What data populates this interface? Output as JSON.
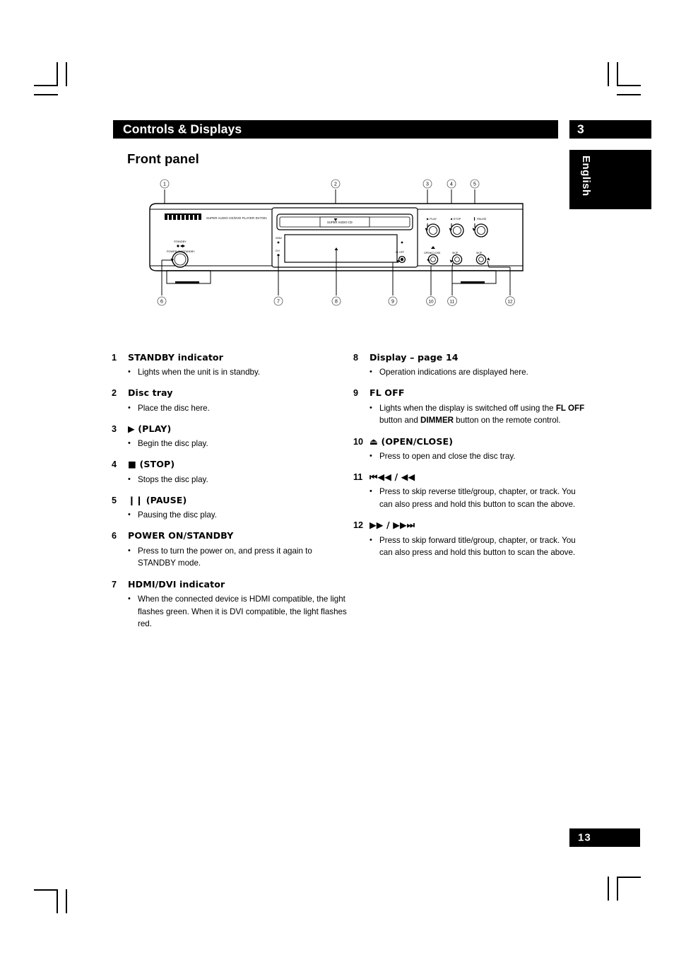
{
  "header": {
    "title": "Controls & Displays",
    "chapter": "3",
    "language_tab": "English"
  },
  "section": {
    "title": "Front panel"
  },
  "figure": {
    "brand": "marantz",
    "model_line": "SUPER AUDIO CD/DVD PLAYER DV7001",
    "disc_label": "SUPER AUDIO CD",
    "labels": {
      "standby": "STANDBY",
      "power": "POWER ON/STANDBY",
      "hdmi": "HDMI",
      "dvi": "DVI",
      "fl_off": "FL OFF",
      "play": "PLAY",
      "stop": "STOP",
      "pause": "PAUSE",
      "open_close": "OPEN/CLOSE",
      "skip_prev": "SKIP",
      "skip_next": "SKIP"
    },
    "callouts_top": [
      "1",
      "2",
      "3",
      "4",
      "5"
    ],
    "callouts_bottom": [
      "6",
      "7",
      "8",
      "9",
      "10",
      "11",
      "12"
    ]
  },
  "items_left": [
    {
      "num": "1",
      "title": "STANDBY indicator",
      "bullets": [
        [
          {
            "t": "Lights when the unit is in standby.",
            "b": false
          }
        ]
      ]
    },
    {
      "num": "2",
      "title": "Disc tray",
      "bullets": [
        [
          {
            "t": "Place the disc here.",
            "b": false
          }
        ]
      ]
    },
    {
      "num": "3",
      "title": "▶ (PLAY)",
      "bullets": [
        [
          {
            "t": "Begin the disc play.",
            "b": false
          }
        ]
      ]
    },
    {
      "num": "4",
      "title": "■ (STOP)",
      "bullets": [
        [
          {
            "t": "Stops the disc play.",
            "b": false
          }
        ]
      ]
    },
    {
      "num": "5",
      "title": "❙❙ (PAUSE)",
      "bullets": [
        [
          {
            "t": "Pausing the disc play.",
            "b": false
          }
        ]
      ]
    },
    {
      "num": "6",
      "title": "POWER ON/STANDBY",
      "bullets": [
        [
          {
            "t": "Press to turn the power on, and press it again to STANDBY mode.",
            "b": false
          }
        ]
      ]
    },
    {
      "num": "7",
      "title": "HDMI/DVI indicator",
      "bullets": [
        [
          {
            "t": "When the connected device is HDMI compatible, the light flashes green. When it is DVI compatible, the light flashes red.",
            "b": false
          }
        ]
      ]
    }
  ],
  "items_right": [
    {
      "num": "8",
      "title": "Display – page 14",
      "bullets": [
        [
          {
            "t": "Operation indications are displayed here.",
            "b": false
          }
        ]
      ]
    },
    {
      "num": "9",
      "title": "FL OFF",
      "bullets": [
        [
          {
            "t": "Lights when the display is switched off using the ",
            "b": false
          },
          {
            "t": "FL OFF",
            "b": true
          },
          {
            "t": " button and ",
            "b": false
          },
          {
            "t": "DIMMER",
            "b": true
          },
          {
            "t": " button on the remote control.",
            "b": false
          }
        ]
      ]
    },
    {
      "num": "10",
      "title": "⏏ (OPEN/CLOSE)",
      "bullets": [
        [
          {
            "t": "Press to open and close the disc tray.",
            "b": false
          }
        ]
      ]
    },
    {
      "num": "11",
      "title": "⏮◀◀ / ◀◀",
      "bullets": [
        [
          {
            "t": "Press to skip reverse title/group, chapter, or track. You can also press and hold this button to scan the above.",
            "b": false
          }
        ]
      ]
    },
    {
      "num": "12",
      "title": "▶▶ / ▶▶⏭",
      "bullets": [
        [
          {
            "t": "Press to skip forward title/group, chapter, or track. You can also press and hold this button to scan the above.",
            "b": false
          }
        ]
      ]
    }
  ],
  "footer": {
    "page_number": "13"
  }
}
